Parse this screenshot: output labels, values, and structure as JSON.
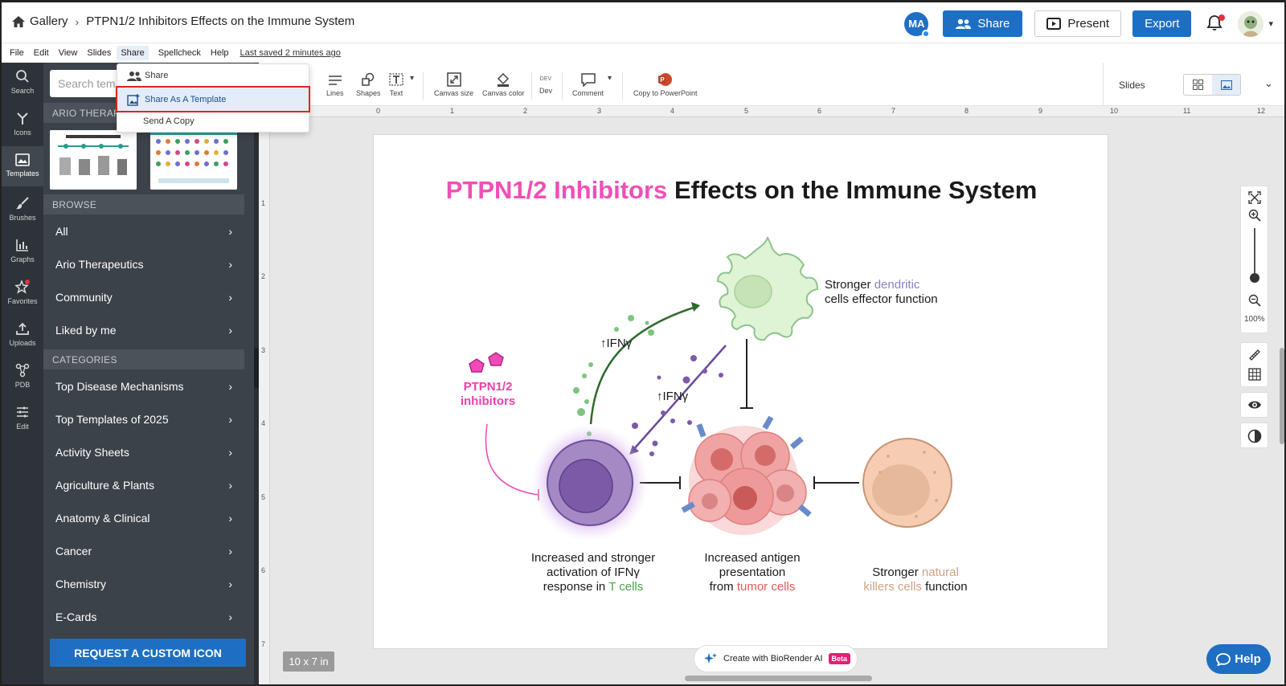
{
  "header": {
    "gallery": "Gallery",
    "doc_title": "PTPN1/2 Inhibitors Effects on the Immune System",
    "avatar_initials": "MA",
    "share": "Share",
    "present": "Present",
    "export": "Export"
  },
  "menu": {
    "file": "File",
    "edit": "Edit",
    "view": "View",
    "slides": "Slides",
    "share": "Share",
    "spellcheck": "Spellcheck",
    "help": "Help",
    "saved": "Last saved 2 minutes ago"
  },
  "dropdown": {
    "share": "Share",
    "share_template": "Share As A Template",
    "send_copy": "Send A Copy"
  },
  "rail": {
    "search": "Search",
    "icons": "Icons",
    "templates": "Templates",
    "brushes": "Brushes",
    "graphs": "Graphs",
    "favorites": "Favorites",
    "uploads": "Uploads",
    "pdb": "PDB",
    "edit": "Edit"
  },
  "panel": {
    "search_placeholder": "Search tem",
    "ario_header": "ARIO THERAP",
    "browse": "BROWSE",
    "browse_items": [
      "All",
      "Ario Therapeutics",
      "Community",
      "Liked by me"
    ],
    "categories": "CATEGORIES",
    "category_items": [
      "Top Disease Mechanisms",
      "Top Templates of 2025",
      "Activity Sheets",
      "Agriculture & Plants",
      "Anatomy & Clinical",
      "Cancer",
      "Chemistry",
      "E-Cards"
    ],
    "request": "REQUEST A CUSTOM ICON"
  },
  "toolbar": {
    "lines": "Lines",
    "shapes": "Shapes",
    "text": "Text",
    "canvas_size": "Canvas size",
    "canvas_color": "Canvas color",
    "dev": "Dev",
    "dev_badge": "DEV",
    "comment": "Comment",
    "copy_ppt": "Copy to PowerPoint",
    "slides": "Slides"
  },
  "ruler": {
    "h": [
      "0",
      "1",
      "2",
      "3",
      "4",
      "5",
      "6",
      "7",
      "8",
      "9",
      "10",
      "11",
      "12"
    ],
    "v": [
      "1",
      "2",
      "3",
      "4",
      "5",
      "6",
      "7"
    ]
  },
  "slide": {
    "title_pink": "PTPN1/2 Inhibitors",
    "title_rest": "Effects on the Immune System",
    "dendritic_1": "Stronger",
    "dendritic_2": "dendritic",
    "dendritic_3": "cells effector function",
    "ifn1": "↑IFNγ",
    "ifn2": "↑IFNγ",
    "inhibitors_1": "PTPN1/2",
    "inhibitors_2": "inhibitors",
    "tcell_1": "Increased and stronger",
    "tcell_2": "activation of IFNγ",
    "tcell_3": "response in",
    "tcell_4": "T cells",
    "tumor_1": "Increased antigen",
    "tumor_2": "presentation",
    "tumor_3": "from",
    "tumor_4": "tumor cells",
    "nk_1": "Stronger",
    "nk_2": "natural",
    "nk_3": "killers cells",
    "nk_4": "function"
  },
  "bottom": {
    "canvas_size": "10 x 7 in",
    "ai": "Create with BioRender AI",
    "beta": "Beta",
    "help": "Help",
    "zoom": "100%"
  }
}
